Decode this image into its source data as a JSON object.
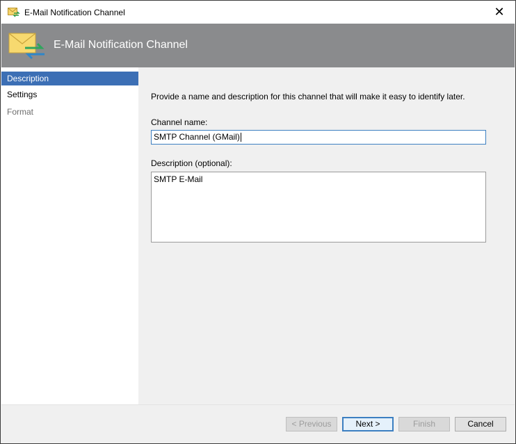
{
  "window": {
    "title": "E-Mail Notification Channel",
    "close_glyph": "✕"
  },
  "banner": {
    "title": "E-Mail Notification Channel",
    "icon": "email-channel-icon"
  },
  "sidebar": {
    "items": [
      {
        "label": "Description",
        "state": "selected"
      },
      {
        "label": "Settings",
        "state": "enabled"
      },
      {
        "label": "Format",
        "state": "disabled"
      }
    ]
  },
  "main": {
    "intro": "Provide a name and description for this channel that will make it easy to identify later.",
    "channel_name_label": "Channel name:",
    "channel_name_value": "SMTP Channel (GMail)",
    "description_label": "Description (optional):",
    "description_value": "SMTP E-Mail"
  },
  "footer": {
    "previous_label": "< Previous",
    "next_label": "Next >",
    "finish_label": "Finish",
    "cancel_label": "Cancel"
  },
  "colors": {
    "banner_bg": "#8a8b8d",
    "selected_nav": "#3c6fb5",
    "focus_border": "#3c7fc1"
  }
}
